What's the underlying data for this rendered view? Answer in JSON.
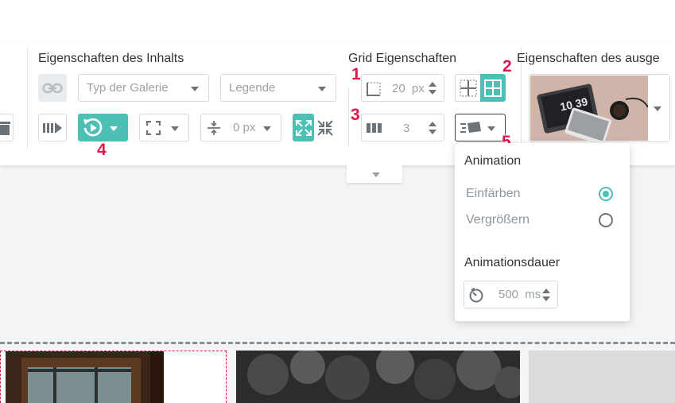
{
  "sections": {
    "content_title": "Eigenschaften des Inhalts",
    "grid_title": "Grid Eigenschaften",
    "selected_title": "Eigenschaften des ausge"
  },
  "content": {
    "gallery_type_placeholder": "Typ der Galerie",
    "legend_placeholder": "Legende",
    "spacing_value": "0",
    "spacing_unit": "px"
  },
  "grid": {
    "gap_value": "20",
    "gap_unit": "px",
    "columns_value": "3"
  },
  "markers": [
    "1",
    "2",
    "3",
    "4",
    "5"
  ],
  "thumbnail": {
    "clock_text": "10 39"
  },
  "popover": {
    "animation_title": "Animation",
    "options": [
      {
        "label": "Einfärben",
        "selected": true
      },
      {
        "label": "Vergrößern",
        "selected": false
      }
    ],
    "duration_title": "Animationsdauer",
    "duration_value": "500",
    "duration_unit": "ms"
  },
  "colors": {
    "accent": "#4dbfb4",
    "marker": "#d9184b"
  }
}
